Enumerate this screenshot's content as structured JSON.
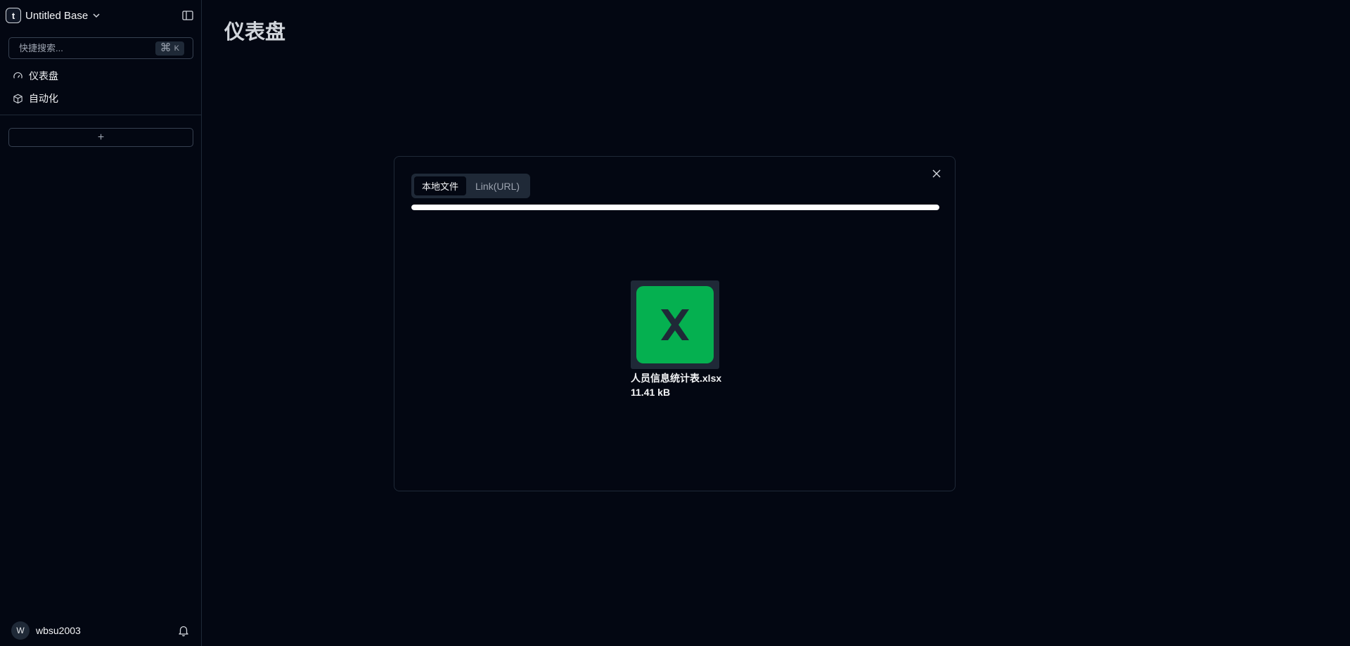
{
  "sidebar": {
    "base_logo_letter": "t",
    "base_title": "Untitled Base",
    "search": {
      "placeholder": "快捷搜索...",
      "shortcut_symbol": "⌘",
      "shortcut_key": "K"
    },
    "items": [
      {
        "label": "仪表盘",
        "icon": "dashboard-gauge-icon"
      },
      {
        "label": "自动化",
        "icon": "automation-cube-icon"
      }
    ],
    "add_label": "+",
    "user": {
      "avatar_letter": "W",
      "name": "wbsu2003"
    }
  },
  "main": {
    "title": "仪表盘"
  },
  "dialog": {
    "tabs": [
      {
        "label": "本地文件",
        "active": true
      },
      {
        "label": "Link(URL)",
        "active": false
      }
    ],
    "progress": 1.0,
    "file": {
      "name": "人员信息统计表.xlsx",
      "size": "11.41 kB",
      "icon": "xlsx-file-icon",
      "icon_color": "#05b050"
    }
  },
  "colors": {
    "background": "#030712",
    "border": "#1f2937",
    "accent_green": "#05b050"
  }
}
